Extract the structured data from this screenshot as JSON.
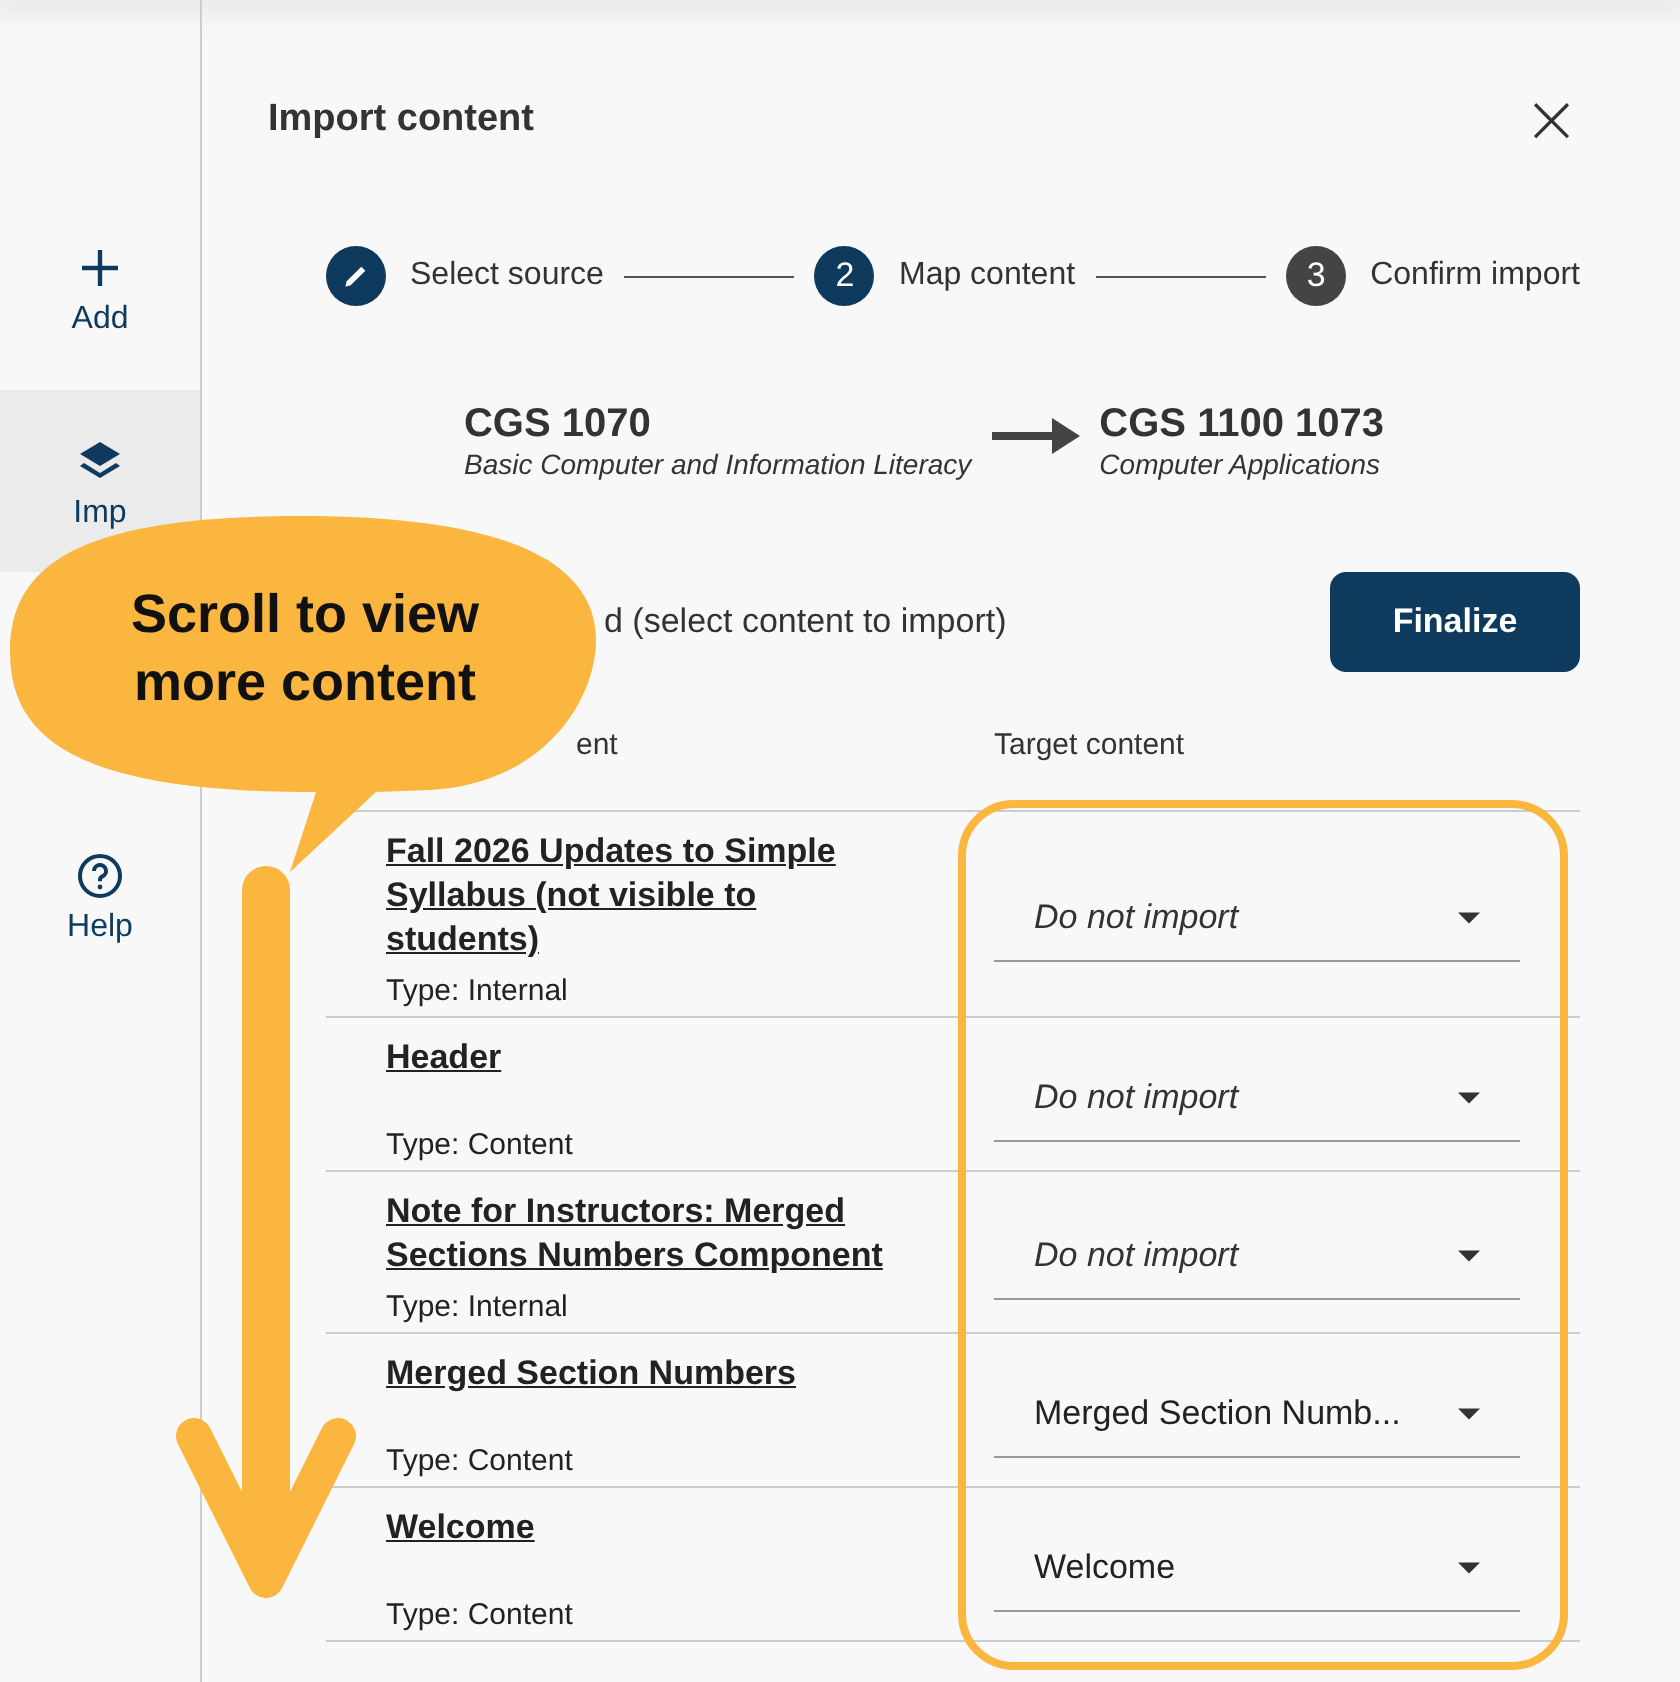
{
  "sidebar": {
    "items": [
      {
        "label": "Add",
        "selected": false
      },
      {
        "label": "Imp",
        "selected": true
      },
      {
        "label": "Help",
        "selected": false
      }
    ]
  },
  "dialog": {
    "title": "Import content",
    "close": "×"
  },
  "steps": [
    {
      "label": "Select source",
      "kind": "done"
    },
    {
      "number": "2",
      "label": "Map content",
      "kind": "current"
    },
    {
      "number": "3",
      "label": "Confirm import",
      "kind": "todo"
    }
  ],
  "source": {
    "code": "CGS 1070",
    "name": "Basic Computer and Information Literacy"
  },
  "target": {
    "code": "CGS 1100 1073",
    "name": "Computer Applications"
  },
  "instruction": "d (select content to import)",
  "finalize": "Finalize",
  "table": {
    "columns": [
      "ent",
      "Target content"
    ],
    "rows": [
      {
        "title": "Fall 2026 Updates to Simple Syllabus (not visible to students)",
        "type": "Type: Internal",
        "placeholder": "Do not import"
      },
      {
        "title": "Header",
        "type": "Type: Content",
        "placeholder": "Do not import"
      },
      {
        "title": "Note for Instructors: Merged Sections Numbers Component",
        "type": "Type: Internal",
        "placeholder": "Do not import"
      },
      {
        "title": "Merged Section Numbers",
        "type": "Type: Content",
        "value": "Merged Section Numb..."
      },
      {
        "title": "Welcome",
        "type": "Type: Content",
        "value": "Welcome"
      }
    ]
  },
  "callout": {
    "text": "Scroll to view more content"
  }
}
